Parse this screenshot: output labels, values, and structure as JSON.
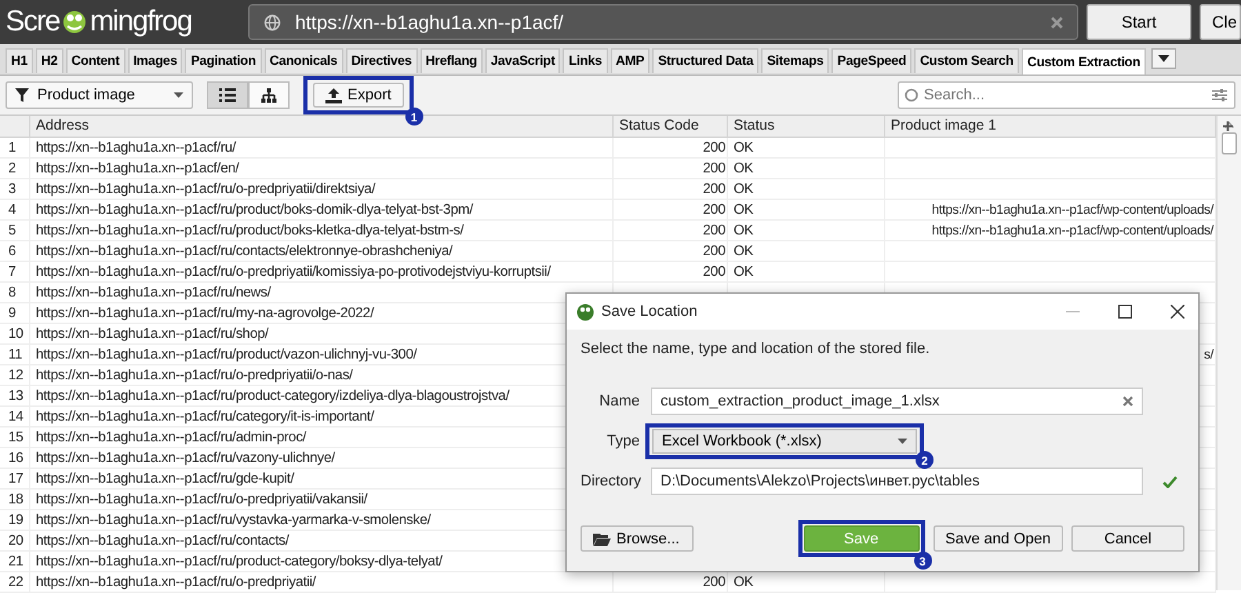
{
  "header": {
    "logo_text_1": "Scre",
    "logo_text_2": "mingfrog",
    "url": "https://xn--b1aghu1a.xn--p1acf/",
    "buttons": [
      "Start",
      "Cle"
    ]
  },
  "tabs": [
    {
      "label": "H1",
      "selected": false
    },
    {
      "label": "H2",
      "selected": false
    },
    {
      "label": "Content",
      "selected": false
    },
    {
      "label": "Images",
      "selected": false
    },
    {
      "label": "Pagination",
      "selected": false
    },
    {
      "label": "Canonicals",
      "selected": false
    },
    {
      "label": "Directives",
      "selected": false
    },
    {
      "label": "Hreflang",
      "selected": false
    },
    {
      "label": "JavaScript",
      "selected": false
    },
    {
      "label": "Links",
      "selected": false
    },
    {
      "label": "AMP",
      "selected": false
    },
    {
      "label": "Structured Data",
      "selected": false
    },
    {
      "label": "Sitemaps",
      "selected": false
    },
    {
      "label": "PageSpeed",
      "selected": false
    },
    {
      "label": "Custom Search",
      "selected": false
    },
    {
      "label": "Custom Extraction",
      "selected": true
    }
  ],
  "toolbar": {
    "filter": "Product image",
    "views": [
      {
        "kind": "list",
        "selected": true
      },
      {
        "kind": "tree",
        "selected": false
      }
    ],
    "export": "Export",
    "export_callout": "1",
    "search_placeholder": "Search..."
  },
  "table": {
    "columns": [
      "Address",
      "Status Code",
      "Status",
      "Product image 1"
    ],
    "rows": [
      {
        "num": "1",
        "address": "https://xn--b1aghu1a.xn--p1acf/ru/",
        "status_code": "200",
        "status": "OK"
      },
      {
        "num": "2",
        "address": "https://xn--b1aghu1a.xn--p1acf/en/",
        "status_code": "200",
        "status": "OK"
      },
      {
        "num": "3",
        "address": "https://xn--b1aghu1a.xn--p1acf/ru/o-predpriyatii/direktsiya/",
        "status_code": "200",
        "status": "OK"
      },
      {
        "num": "4",
        "address": "https://xn--b1aghu1a.xn--p1acf/ru/product/boks-domik-dlya-telyat-bst-3pm/",
        "status_code": "200",
        "status": "OK",
        "image": "https://xn--b1aghu1a.xn--p1acf/wp-content/uploads/"
      },
      {
        "num": "5",
        "address": "https://xn--b1aghu1a.xn--p1acf/ru/product/boks-kletka-dlya-telyat-bstm-s/",
        "status_code": "200",
        "status": "OK",
        "image": "https://xn--b1aghu1a.xn--p1acf/wp-content/uploads/"
      },
      {
        "num": "6",
        "address": "https://xn--b1aghu1a.xn--p1acf/ru/contacts/elektronnye-obrashcheniya/",
        "status_code": "200",
        "status": "OK"
      },
      {
        "num": "7",
        "address": "https://xn--b1aghu1a.xn--p1acf/ru/o-predpriyatii/komissiya-po-protivodejstviyu-korruptsii/",
        "status_code": "200",
        "status": "OK"
      },
      {
        "num": "8",
        "address": "https://xn--b1aghu1a.xn--p1acf/ru/news/"
      },
      {
        "num": "9",
        "address": "https://xn--b1aghu1a.xn--p1acf/ru/my-na-agrovolge-2022/"
      },
      {
        "num": "10",
        "address": "https://xn--b1aghu1a.xn--p1acf/ru/shop/"
      },
      {
        "num": "11",
        "address": "https://xn--b1aghu1a.xn--p1acf/ru/product/vazon-ulichnyj-vu-300/",
        "image": "s/"
      },
      {
        "num": "12",
        "address": "https://xn--b1aghu1a.xn--p1acf/ru/o-predpriyatii/o-nas/"
      },
      {
        "num": "13",
        "address": "https://xn--b1aghu1a.xn--p1acf/ru/product-category/izdeliya-dlya-blagoustrojstva/"
      },
      {
        "num": "14",
        "address": "https://xn--b1aghu1a.xn--p1acf/ru/category/it-is-important/"
      },
      {
        "num": "15",
        "address": "https://xn--b1aghu1a.xn--p1acf/ru/admin-proc/"
      },
      {
        "num": "16",
        "address": "https://xn--b1aghu1a.xn--p1acf/ru/vazony-ulichnye/"
      },
      {
        "num": "17",
        "address": "https://xn--b1aghu1a.xn--p1acf/ru/gde-kupit/"
      },
      {
        "num": "18",
        "address": "https://xn--b1aghu1a.xn--p1acf/ru/o-predpriyatii/vakansii/"
      },
      {
        "num": "19",
        "address": "https://xn--b1aghu1a.xn--p1acf/ru/vystavka-yarmarka-v-smolenske/"
      },
      {
        "num": "20",
        "address": "https://xn--b1aghu1a.xn--p1acf/ru/contacts/"
      },
      {
        "num": "21",
        "address": "https://xn--b1aghu1a.xn--p1acf/ru/product-category/boksy-dlya-telyat/"
      },
      {
        "num": "22",
        "address": "https://xn--b1aghu1a.xn--p1acf/ru/o-predpriyatii/",
        "status_code": "200",
        "status": "OK"
      }
    ]
  },
  "dialog": {
    "title": "Save Location",
    "description": "Select the name, type and location of the stored file.",
    "name_label": "Name",
    "name_value": "custom_extraction_product_image_1.xlsx",
    "type_label": "Type",
    "type_value": "Excel Workbook (*.xlsx)",
    "type_callout": "2",
    "directory_label": "Directory",
    "directory_value": "D:\\Documents\\Alekzo\\Projects\\инвет.рус\\tables",
    "directory_valid": true,
    "buttons": [
      {
        "label": "Browse...",
        "kind": "browse"
      },
      {
        "label": "Save",
        "kind": "primary",
        "callout": "3"
      },
      {
        "label": "Save and Open",
        "kind": "normal"
      },
      {
        "label": "Cancel",
        "kind": "normal"
      }
    ]
  }
}
